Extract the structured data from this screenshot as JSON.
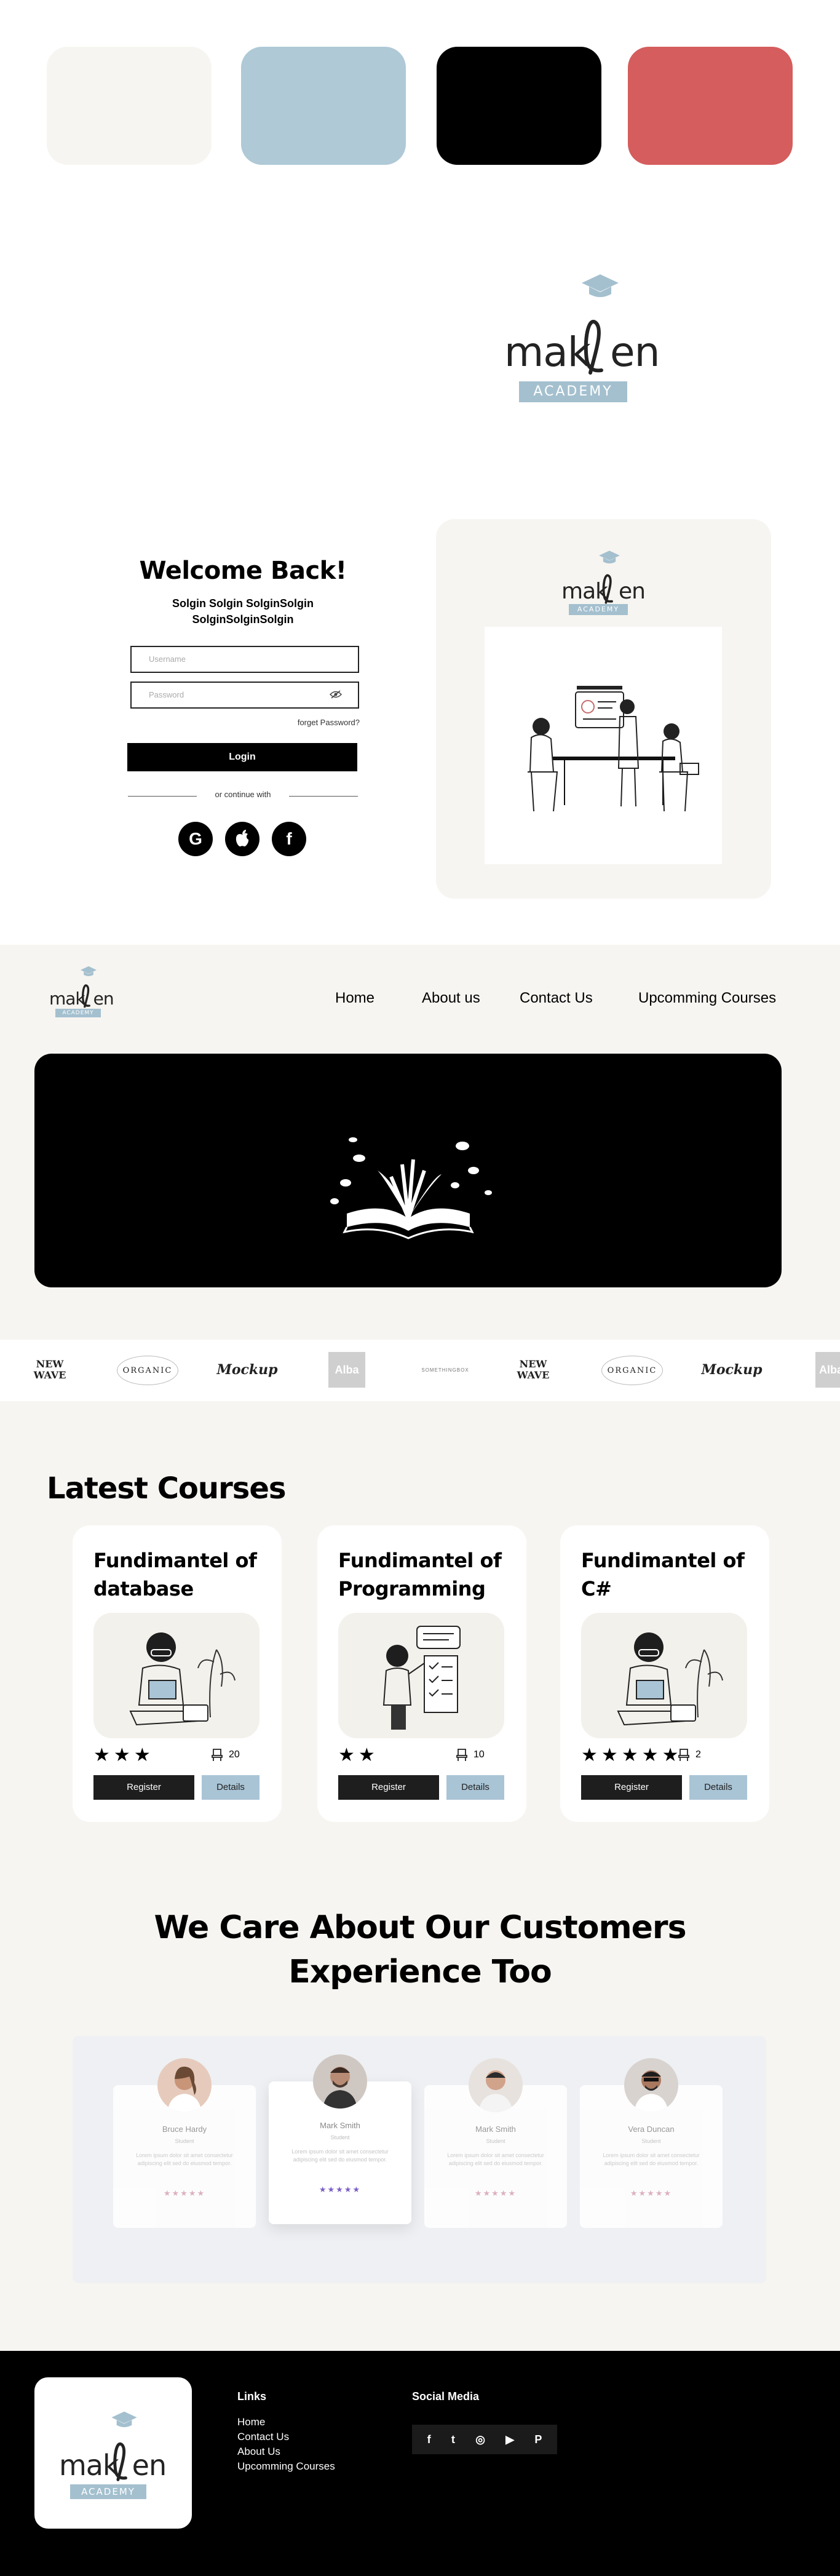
{
  "palette": {
    "swatches": [
      "#f7f5f1",
      "#afc9d6",
      "#000000",
      "#d55d5d"
    ]
  },
  "brand": {
    "logo_word_left": "mak",
    "logo_word_right": "en",
    "logo_band": "ACADEMY"
  },
  "login": {
    "title": "Welcome Back!",
    "subtitle": "Solgin Solgin SolginSolgin SolginSolginSolgin",
    "username_placeholder": "Username",
    "password_placeholder": "Password",
    "forgot": "forget Password?",
    "login_label": "Login",
    "or_continue": "or continue with",
    "social": [
      {
        "icon": "google-icon",
        "glyph": "G"
      },
      {
        "icon": "apple-icon",
        "glyph": ""
      },
      {
        "icon": "facebook-icon",
        "glyph": "f"
      }
    ]
  },
  "nav": {
    "links": [
      "Home",
      "About us",
      "Contact Us",
      "Upcomming Courses"
    ]
  },
  "brands": {
    "items": [
      "NEW WAVE",
      "ORGANIC",
      "Mockup",
      "Alba",
      "SOMETHINGBOX",
      "NEW WAVE",
      "ORGANIC",
      "Mockup",
      "Alba"
    ]
  },
  "courses": {
    "title": "Latest Courses",
    "items": [
      {
        "title": "Fundimantel of database",
        "stars": 3,
        "seats": "20",
        "register": "Register",
        "details": "Details"
      },
      {
        "title": "Fundimantel of Programming",
        "stars": 2,
        "seats": "10",
        "register": "Register",
        "details": "Details"
      },
      {
        "title": "Fundimantel of C#",
        "stars": 5,
        "seats": "2",
        "register": "Register",
        "details": "Details"
      }
    ]
  },
  "testimonials": {
    "title": "We Care About Our Customers Experience Too",
    "items": [
      {
        "name": "Bruce Hardy",
        "role": "Student",
        "text": "Lorem ipsum dolor sit amet consectetur adipiscing elit sed do eiusmod tempor.",
        "stars": "★★★★★"
      },
      {
        "name": "Mark Smith",
        "role": "Student",
        "text": "Lorem ipsum dolor sit amet consectetur adipiscing elit sed do eiusmod tempor.",
        "stars": "★★★★★"
      },
      {
        "name": "Mark Smith",
        "role": "Student",
        "text": "Lorem ipsum dolor sit amet consectetur adipiscing elit sed do eiusmod tempor.",
        "stars": "★★★★★"
      },
      {
        "name": "Vera Duncan",
        "role": "Student",
        "text": "Lorem ipsum dolor sit amet consectetur adipiscing elit sed do eiusmod tempor.",
        "stars": "★★★★★"
      }
    ]
  },
  "footer": {
    "links_title": "Links",
    "links": [
      "Home",
      "Contact Us",
      "About Us",
      "Upcomming Courses"
    ],
    "social_title": "Social Media",
    "social": [
      {
        "icon": "facebook-icon",
        "glyph": "f"
      },
      {
        "icon": "twitter-icon",
        "glyph": "t"
      },
      {
        "icon": "instagram-icon",
        "glyph": "◎"
      },
      {
        "icon": "youtube-icon",
        "glyph": "▶"
      },
      {
        "icon": "pinterest-icon",
        "glyph": "P"
      }
    ]
  }
}
